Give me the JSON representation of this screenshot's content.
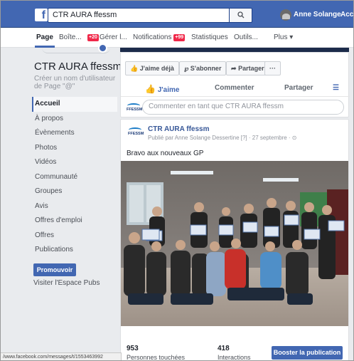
{
  "topbar": {
    "logo": "f",
    "search_value": "CTR AURA ffessm",
    "search_icon": "search-icon",
    "user_name": "Anne Solange",
    "extra_link": "Accueil"
  },
  "pagenav": {
    "items": [
      {
        "label": "Page"
      },
      {
        "label": "Boîte..."
      },
      {
        "label": "Gérer l...",
        "badge": "+20"
      },
      {
        "label": "Notifications",
        "badge": "+99"
      },
      {
        "label": "Statistiques"
      },
      {
        "label": "Outils..."
      },
      {
        "label": "Plus ▾"
      }
    ]
  },
  "sidebar": {
    "page_name": "CTR AURA ffessm",
    "username_hint": "Créer un nom d'utilisateur de Page \"@\"",
    "items": [
      {
        "label": "Accueil"
      },
      {
        "label": "À propos"
      },
      {
        "label": "Évènements"
      },
      {
        "label": "Photos"
      },
      {
        "label": "Vidéos"
      },
      {
        "label": "Communauté"
      },
      {
        "label": "Groupes"
      },
      {
        "label": "Avis"
      },
      {
        "label": "Offres d'emploi"
      },
      {
        "label": "Offres"
      },
      {
        "label": "Publications"
      }
    ],
    "promote_label": "Promouvoir",
    "ads_link": "Visiter l'Espace Pubs"
  },
  "actions": {
    "like_page": "J'aime déjà",
    "follow": "S'abonner",
    "share": "Partager",
    "more": "···"
  },
  "reactions": {
    "like": "J'aime",
    "comment": "Commenter",
    "share": "Partager"
  },
  "comment_box": {
    "placeholder": "Commenter en tant que CTR AURA ffessm",
    "logo_text": "FFESSM"
  },
  "post": {
    "author": "CTR AURA ffessm",
    "meta": "Publié par Anne Solange Dessertine [?] · 27 septembre · ⊙",
    "text": "Bravo aux nouveaux GP",
    "logo_text": "FFESSM",
    "stats": [
      {
        "value": "953",
        "label": "Personnes touchées"
      },
      {
        "value": "418",
        "label": "Interactions"
      }
    ],
    "boost_label": "Booster la publication"
  },
  "statusbar": {
    "url": "/www.facebook.com/messages/t/1553463992"
  },
  "colors": {
    "facebook_blue": "#4267b2",
    "badge_red": "#f02849",
    "link_blue": "#385898"
  }
}
